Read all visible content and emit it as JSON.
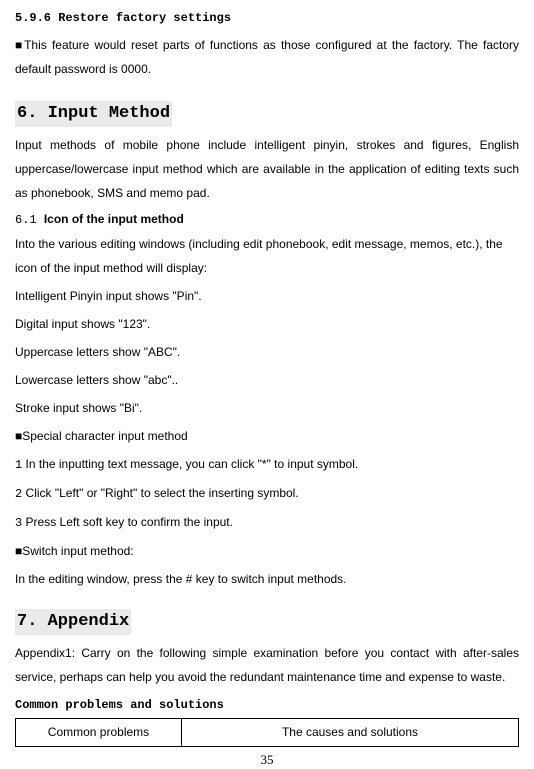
{
  "s596": {
    "heading": "5.9.6 Restore factory settings",
    "bullet": "■",
    "text": "This feature would reset parts of functions as those configured at the factory. The factory default password is 0000."
  },
  "s6": {
    "heading": "6. Input Method",
    "intro": "Input methods of mobile phone include intelligent pinyin, strokes and figures, English uppercase/lowercase input method which are available in the application of editing texts such as phonebook, SMS and memo pad."
  },
  "s61": {
    "prefix": "6.1 ",
    "title": "Icon of the input method",
    "lines": [
      "Into the various editing windows (including edit phonebook, edit message, memos, etc.), the icon of the input method will display:",
      "Intelligent Pinyin input shows \"Pin\".",
      "Digital input shows \"123\".",
      "Uppercase letters show \"ABC\".",
      "Lowercase letters show \"abc\"..",
      "Stroke input shows \"Bi\"."
    ],
    "special_bullet": "■",
    "special_title": "Special character input method",
    "special_steps": [
      {
        "n": "1",
        "t": " In the inputting text message, you can click \"*\" to input symbol."
      },
      {
        "n": "2",
        "t": " Click \"Left\" or \"Right\" to select the inserting symbol."
      },
      {
        "n": "3",
        "t": " Press Left soft key to confirm the input."
      }
    ],
    "switch_bullet": "■",
    "switch_title": "Switch input method:",
    "switch_text": "In the editing window, press the # key to switch input methods."
  },
  "s7": {
    "heading": "7. Appendix",
    "text": "Appendix1: Carry on the following simple examination before you contact with after-sales service, perhaps can help you avoid the redundant maintenance time and expense to waste."
  },
  "tbl": {
    "heading": "Common problems and solutions",
    "col1": "Common problems",
    "col2": "The causes and solutions"
  },
  "page": "35"
}
